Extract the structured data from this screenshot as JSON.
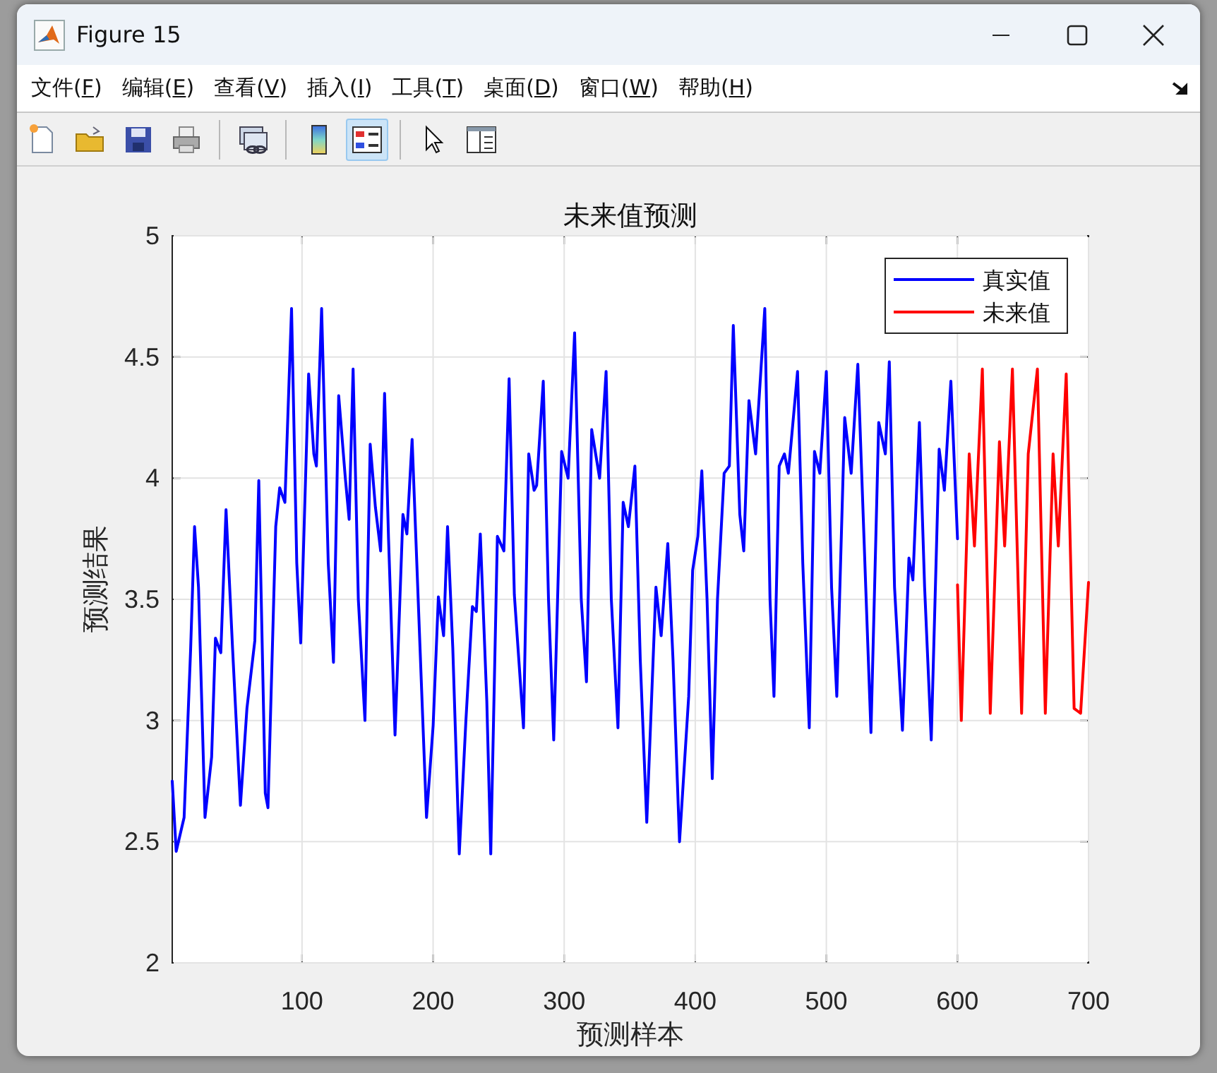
{
  "window": {
    "title": "Figure 15"
  },
  "menu": [
    {
      "before": "文件(",
      "key": "F",
      "after": ")"
    },
    {
      "before": "编辑(",
      "key": "E",
      "after": ")"
    },
    {
      "before": "查看(",
      "key": "V",
      "after": ")"
    },
    {
      "before": "插入(",
      "key": "I",
      "after": ")"
    },
    {
      "before": "工具(",
      "key": "T",
      "after": ")"
    },
    {
      "before": "桌面(",
      "key": "D",
      "after": ")"
    },
    {
      "before": "窗口(",
      "key": "W",
      "after": ")"
    },
    {
      "before": "帮助(",
      "key": "H",
      "after": ")"
    }
  ],
  "toolbar": [
    {
      "kind": "new",
      "pressed": false
    },
    {
      "kind": "open",
      "pressed": false
    },
    {
      "kind": "save",
      "pressed": false
    },
    {
      "kind": "print",
      "pressed": false
    },
    {
      "kind": "separator"
    },
    {
      "kind": "link",
      "pressed": false
    },
    {
      "kind": "separator"
    },
    {
      "kind": "colorbar",
      "pressed": false
    },
    {
      "kind": "legend",
      "pressed": true
    },
    {
      "kind": "separator"
    },
    {
      "kind": "pointer",
      "pressed": false
    },
    {
      "kind": "inspector",
      "pressed": false
    }
  ],
  "chart_data": {
    "type": "line",
    "title": "未来值预测",
    "xlabel": "预测样本",
    "ylabel": "预测结果",
    "xlim": [
      1,
      700
    ],
    "ylim": [
      2,
      5
    ],
    "grid": true,
    "legend": true,
    "xticks": [
      100,
      200,
      300,
      400,
      500,
      600,
      700
    ],
    "yticks": [
      {
        "value": 2,
        "label": "2"
      },
      {
        "value": 2.5,
        "label": "2.5"
      },
      {
        "value": 3,
        "label": "3"
      },
      {
        "value": 3.5,
        "label": "3.5"
      },
      {
        "value": 4,
        "label": "4"
      },
      {
        "value": 4.5,
        "label": "4.5"
      },
      {
        "value": 5,
        "label": "5"
      }
    ],
    "series": [
      {
        "name": "真实值",
        "color": "#0000ff",
        "x": [
          1,
          4,
          10,
          15,
          18,
          21,
          26,
          31,
          34,
          38,
          42,
          47,
          53,
          58,
          64,
          67,
          72,
          74,
          80,
          83,
          87,
          92,
          96,
          99,
          105,
          109,
          111,
          115,
          120,
          124,
          128,
          133,
          136,
          139,
          143,
          148,
          152,
          156,
          160,
          163,
          166,
          171,
          177,
          180,
          184,
          190,
          195,
          200,
          204,
          208,
          211,
          215,
          220,
          225,
          230,
          233,
          236,
          241,
          244,
          249,
          254,
          258,
          262,
          269,
          273,
          277,
          279,
          284,
          288,
          292,
          298,
          303,
          308,
          313,
          317,
          321,
          327,
          332,
          336,
          341,
          345,
          349,
          354,
          358,
          363,
          370,
          374,
          379,
          383,
          388,
          395,
          398,
          402,
          405,
          409,
          413,
          417,
          422,
          426,
          429,
          434,
          437,
          441,
          446,
          453,
          457,
          460,
          464,
          468,
          471,
          478,
          482,
          487,
          491,
          495,
          500,
          504,
          508,
          514,
          519,
          524,
          530,
          534,
          540,
          545,
          548,
          552,
          558,
          563,
          566,
          571,
          575,
          580,
          586,
          590,
          595,
          600
        ],
        "values": [
          2.75,
          2.46,
          2.6,
          3.29,
          3.8,
          3.55,
          2.6,
          2.85,
          3.34,
          3.28,
          3.87,
          3.3,
          2.65,
          3.05,
          3.33,
          3.99,
          2.7,
          2.64,
          3.8,
          3.96,
          3.9,
          4.7,
          3.65,
          3.32,
          4.43,
          4.1,
          4.05,
          4.7,
          3.65,
          3.24,
          4.34,
          4.0,
          3.83,
          4.45,
          3.5,
          3.0,
          4.14,
          3.88,
          3.7,
          4.35,
          3.75,
          2.94,
          3.85,
          3.77,
          4.16,
          3.3,
          2.6,
          2.98,
          3.51,
          3.35,
          3.8,
          3.3,
          2.45,
          3.0,
          3.47,
          3.45,
          3.77,
          3.08,
          2.45,
          3.76,
          3.7,
          4.41,
          3.52,
          2.97,
          4.1,
          3.95,
          3.97,
          4.4,
          3.5,
          2.92,
          4.11,
          4.0,
          4.6,
          3.5,
          3.16,
          4.2,
          4.0,
          4.44,
          3.5,
          2.97,
          3.9,
          3.8,
          4.05,
          3.25,
          2.58,
          3.55,
          3.35,
          3.73,
          3.25,
          2.5,
          3.1,
          3.62,
          3.76,
          4.03,
          3.5,
          2.76,
          3.5,
          4.02,
          4.05,
          4.63,
          3.85,
          3.7,
          4.32,
          4.1,
          4.7,
          3.5,
          3.1,
          4.05,
          4.1,
          4.02,
          4.44,
          3.65,
          2.97,
          4.11,
          4.02,
          4.44,
          3.55,
          3.1,
          4.25,
          4.02,
          4.47,
          3.55,
          2.95,
          4.23,
          4.1,
          4.48,
          3.55,
          2.96,
          3.67,
          3.58,
          4.23,
          3.55,
          2.92,
          4.12,
          3.95,
          4.4,
          3.75
        ]
      },
      {
        "name": "未来值",
        "color": "#ff0000",
        "x": [
          600,
          603,
          609,
          613,
          619,
          625,
          632,
          636,
          642,
          649,
          654,
          661,
          667,
          673,
          677,
          683,
          689,
          694,
          700
        ],
        "values": [
          3.56,
          3.0,
          4.1,
          3.72,
          4.45,
          3.03,
          4.15,
          3.72,
          4.45,
          3.03,
          4.1,
          4.45,
          3.03,
          4.1,
          3.72,
          4.43,
          3.05,
          3.03,
          3.57
        ]
      }
    ]
  }
}
